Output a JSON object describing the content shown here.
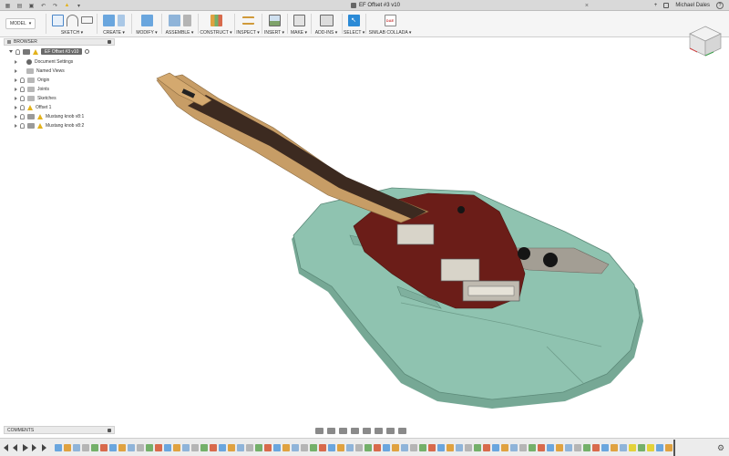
{
  "titlebar": {
    "document_title": "EF Offset #3 v10",
    "user_name": "Michael Dales",
    "help_label": "?",
    "plus_label": "+"
  },
  "ribbon": {
    "workspace_label": "MODEL",
    "groups": [
      {
        "id": "sketch",
        "label": "SKETCH ▾"
      },
      {
        "id": "create",
        "label": "CREATE ▾"
      },
      {
        "id": "modify",
        "label": "MODIFY ▾"
      },
      {
        "id": "assemble",
        "label": "ASSEMBLE ▾"
      },
      {
        "id": "construct",
        "label": "CONSTRUCT ▾"
      },
      {
        "id": "inspect",
        "label": "INSPECT ▾"
      },
      {
        "id": "insert",
        "label": "INSERT ▾"
      },
      {
        "id": "make",
        "label": "MAKE ▾"
      },
      {
        "id": "addins",
        "label": "ADD-INS ▾"
      },
      {
        "id": "select",
        "label": "SELECT ▾"
      },
      {
        "id": "simlab",
        "label": "SIMLAB COLLADA ▾"
      }
    ],
    "simlab_icon_text": "DAE"
  },
  "browser": {
    "title": "BROWSER",
    "root_label": "EF Offset #3 v10",
    "items": [
      {
        "label": "Document Settings",
        "icon": "gear-icon"
      },
      {
        "label": "Named Views",
        "icon": "folder-icon"
      },
      {
        "label": "Origin",
        "icon": "folder-icon"
      },
      {
        "label": "Joints",
        "icon": "folder-icon"
      },
      {
        "label": "Sketches",
        "icon": "folder-icon"
      },
      {
        "label": "Offset 1",
        "icon": "warning-icon"
      },
      {
        "label": "Mustang knob v8:1",
        "icon": "component-icon"
      },
      {
        "label": "Mustang knob v8:2",
        "icon": "component-icon"
      }
    ]
  },
  "comments": {
    "title": "COMMENTS"
  },
  "colors": {
    "guitar_body": "#8fc3b0",
    "guitar_body_edge": "#76a895",
    "pickguard": "#6b1d18",
    "fretboard": "#3c2a20",
    "neck": "#c79d66",
    "select_blue": "#2b8ad6",
    "warning": "#e3b21b"
  }
}
